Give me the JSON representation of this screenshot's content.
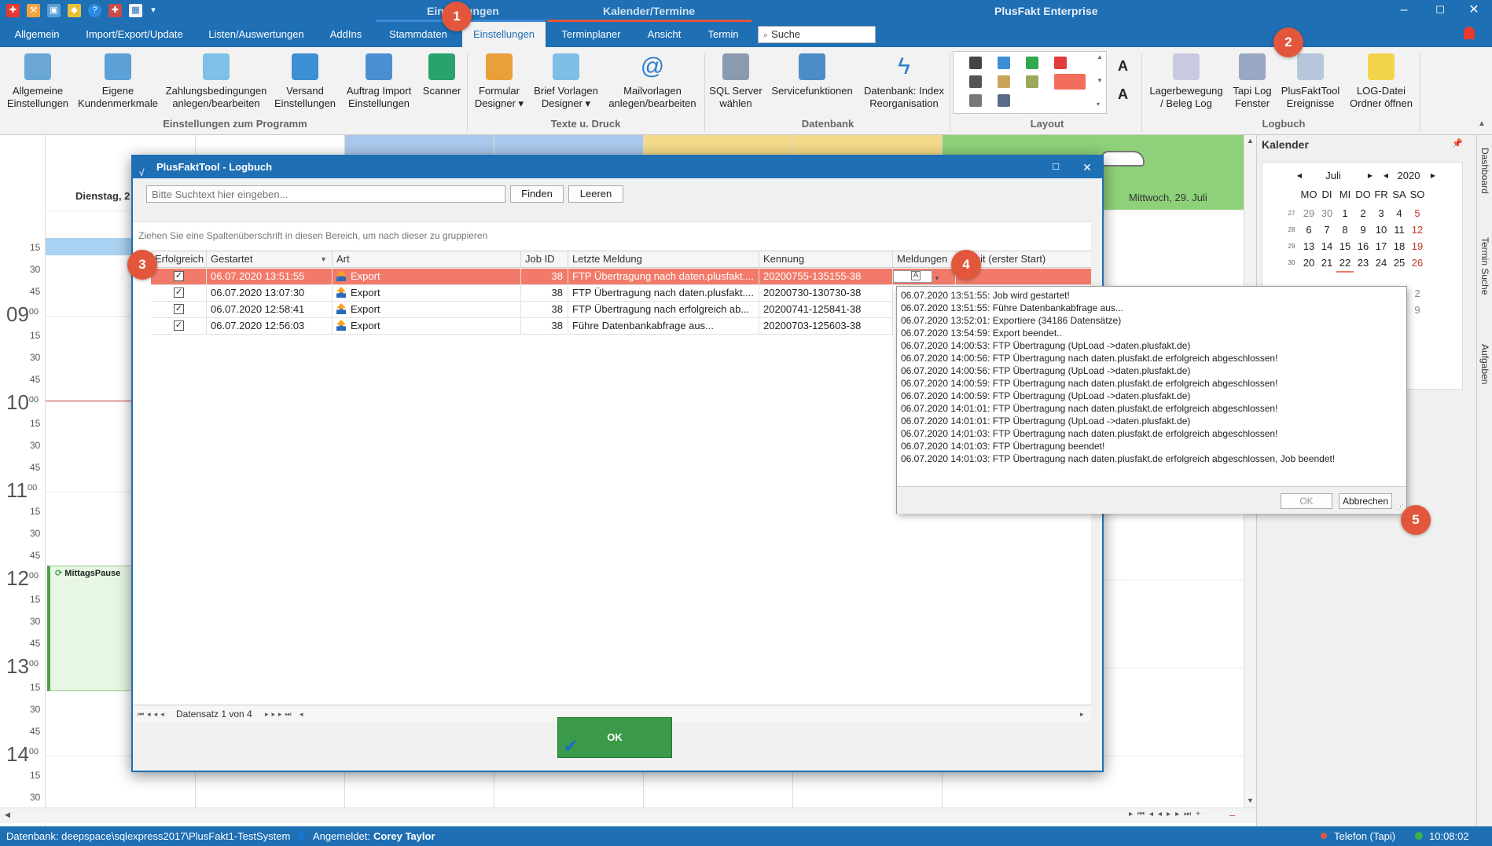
{
  "titlebar": {
    "context_tab_1": "Einstellungen",
    "context_tab_2": "Kalender/Termine",
    "app_title": "PlusFakt Enterprise",
    "colors": {
      "bar": "#1e6fb4",
      "context_1": "#3c8ad6",
      "context_2": "#e2573c"
    }
  },
  "menu": {
    "tabs": [
      "Allgemein",
      "Import/Export/Update",
      "Listen/Auswertungen",
      "AddIns",
      "Stammdaten",
      "Einstellungen",
      "Terminplaner",
      "Ansicht",
      "Termin"
    ],
    "active": "Einstellungen",
    "search_label": "Suche"
  },
  "ribbon": {
    "buttons": [
      "Allgemeine Einstellungen",
      "Eigene Kundenmerkmale",
      "Zahlungsbedingungen anlegen/bearbeiten",
      "Versand Einstellungen",
      "Auftrag Import Einstellungen",
      "Scanner",
      "Formular Designer ▾",
      "Brief Vorlagen Designer ▾",
      "Mailvorlagen anlegen/bearbeiten",
      "SQL Server wählen",
      "Servicefunktionen",
      "Datenbank: Index Reorganisation",
      "Lagerbewegung / Beleg Log",
      "Tapi Log Fenster",
      "PlusFaktTool Ereignisse",
      "LOG-Datei Ordner öffnen"
    ],
    "groups": [
      "Einstellungen zum Programm",
      "Texte u. Druck",
      "Datenbank",
      "Layout",
      "Logbuch"
    ]
  },
  "calendar": {
    "day_left": "Dienstag, 2",
    "day_right": "Mittwoch, 29. Juli",
    "hours": [
      "09",
      "10",
      "11",
      "12",
      "13",
      "14"
    ],
    "minutes": [
      "15",
      "30",
      "45"
    ],
    "hour_suffix": "00",
    "event": "MittagsPause"
  },
  "minical": {
    "title": "Kalender",
    "month": "Juli",
    "year": "2020",
    "weekdays": [
      "MO",
      "DI",
      "MI",
      "DO",
      "FR",
      "SA",
      "SO"
    ],
    "weeks": [
      {
        "wk": "27",
        "days": [
          "29",
          "30",
          "1",
          "2",
          "3",
          "4",
          "5"
        ]
      },
      {
        "wk": "28",
        "days": [
          "6",
          "7",
          "8",
          "9",
          "10",
          "11",
          "12"
        ]
      },
      {
        "wk": "29",
        "days": [
          "13",
          "14",
          "15",
          "16",
          "17",
          "18",
          "19"
        ]
      },
      {
        "wk": "30",
        "days": [
          "20",
          "21",
          "22",
          "23",
          "24",
          "25",
          "26"
        ]
      }
    ],
    "extra": [
      "2",
      "9"
    ]
  },
  "sidetabs": [
    "Dashboard",
    "Termin Suche",
    "Aufgaben"
  ],
  "statusbar": {
    "database": "Datenbank: deepspace\\sqlexpress2017\\PlusFakt1-TestSystem",
    "login_label": "Angemeldet:",
    "user": "Corey Taylor",
    "phone": "Telefon (Tapi)",
    "clock": "10:08:02"
  },
  "dialog": {
    "title": "PlusFaktTool - Logbuch",
    "search_placeholder": "Bitte Suchtext hier eingeben...",
    "find_button": "Finden",
    "clear_button": "Leeren",
    "group_hint": "Ziehen Sie eine Spaltenüberschrift in diesen Bereich, um nach dieser zu gruppieren",
    "columns": [
      "Erfolgreich",
      "Gestartet",
      "Art",
      "Job ID",
      "Letzte Meldung",
      "Kennung",
      "Meldungen",
      "Zeit (erster Start)"
    ],
    "rows": [
      {
        "check": "✓",
        "started": "06.07.2020 13:51:55",
        "type": "Export",
        "job": "38",
        "last": "FTP Übertragung nach daten.plusfakt....",
        "id": "20200755-135155-38"
      },
      {
        "check": "✓",
        "started": "06.07.2020 13:07:30",
        "type": "Export",
        "job": "38",
        "last": "FTP Übertragung nach daten.plusfakt....",
        "id": "20200730-130730-38"
      },
      {
        "check": "✓",
        "started": "06.07.2020 12:58:41",
        "type": "Export",
        "job": "38",
        "last": "FTP Übertragung nach  erfolgreich ab...",
        "id": "20200741-125841-38"
      },
      {
        "check": "✓",
        "started": "06.07.2020 12:56:03",
        "type": "Export",
        "job": "38",
        "last": "Führe Datenbankabfrage aus...",
        "id": "20200703-125603-38"
      }
    ],
    "record_nav": "Datensatz 1 von 4",
    "ok_label": "OK"
  },
  "popup": {
    "lines": [
      "06.07.2020 13:51:55: Job wird gestartet!",
      "06.07.2020 13:51:55: Führe Datenbankabfrage aus...",
      "06.07.2020 13:52:01: Exportiere (34186 Datensätze)",
      "06.07.2020 13:54:59: Export beendet..",
      "06.07.2020 14:00:53: FTP Übertragung (UpLoad ->daten.plusfakt.de)",
      "06.07.2020 14:00:56: FTP Übertragung nach daten.plusfakt.de erfolgreich abgeschlossen!",
      "06.07.2020 14:00:56: FTP Übertragung (UpLoad ->daten.plusfakt.de)",
      "06.07.2020 14:00:59: FTP Übertragung nach daten.plusfakt.de erfolgreich abgeschlossen!",
      "06.07.2020 14:00:59: FTP Übertragung (UpLoad ->daten.plusfakt.de)",
      "06.07.2020 14:01:01: FTP Übertragung nach daten.plusfakt.de erfolgreich abgeschlossen!",
      "06.07.2020 14:01:01: FTP Übertragung (UpLoad ->daten.plusfakt.de)",
      "06.07.2020 14:01:03: FTP Übertragung nach daten.plusfakt.de erfolgreich abgeschlossen!",
      "06.07.2020 14:01:03: FTP Übertragung beendet!",
      "06.07.2020 14:01:03: FTP Übertragung nach daten.plusfakt.de erfolgreich abgeschlossen, Job beendet!"
    ],
    "ok_label": "OK",
    "cancel_label": "Abbrechen"
  },
  "badges": [
    "1",
    "2",
    "3",
    "4",
    "5"
  ],
  "colors": {
    "selected_row": "#f27a6a",
    "badge": "#e2573c",
    "ok_button": "#3a9a4a"
  }
}
